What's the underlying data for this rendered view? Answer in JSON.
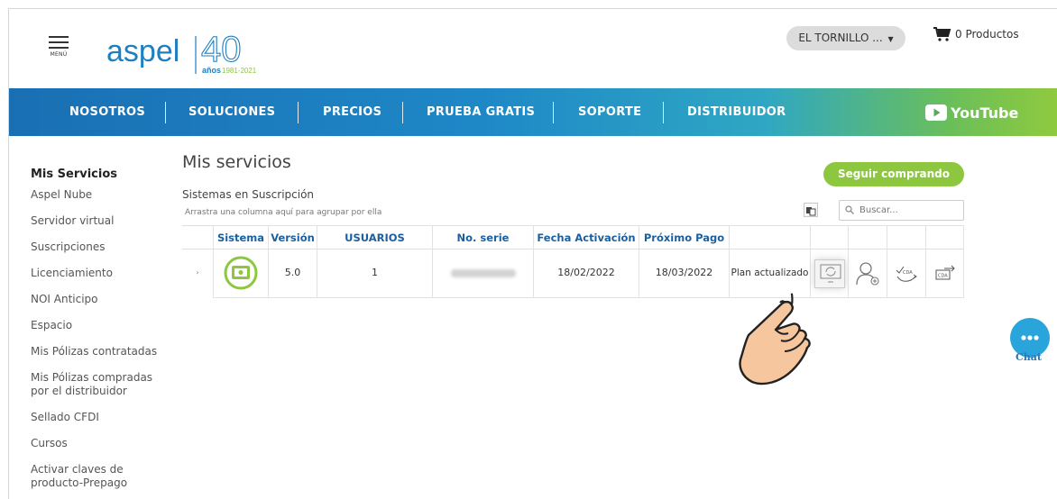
{
  "header": {
    "menu_label": "MENÚ",
    "brand": "aspel",
    "anniversary_number": "40",
    "anniversary_text": "años",
    "anniversary_years": "1981-2021",
    "account_label": "EL TORNILLO ...",
    "cart_label": "0 Productos"
  },
  "nav": {
    "items": [
      "NOSOTROS",
      "SOLUCIONES",
      "PRECIOS",
      "PRUEBA GRATIS",
      "SOPORTE",
      "DISTRIBUIDOR"
    ],
    "youtube_label": "YouTube"
  },
  "sidebar": {
    "title": "Mis Servicios",
    "items": [
      "Aspel Nube",
      "Servidor virtual",
      "Suscripciones",
      "Licenciamiento",
      "NOI Anticipo",
      "Espacio",
      "Mis Pólizas contratadas",
      "Mis Pólizas compradas por el distribuidor",
      "Sellado CFDI",
      "Cursos",
      "Activar claves de producto-Prepago"
    ]
  },
  "main": {
    "title": "Mis servicios",
    "subtitle": "Sistemas en Suscripción",
    "group_hint": "Arrastra una columna aquí para agrupar por ella",
    "buy_button": "Seguir comprando",
    "search_placeholder": "Buscar...",
    "columns": [
      "Sistema",
      "Versión",
      "USUARIOS",
      "No. serie",
      "Fecha Activación",
      "Próximo Pago"
    ],
    "row": {
      "version": "5.0",
      "users": "1",
      "activation_date": "18/02/2022",
      "next_payment": "18/03/2022",
      "plan_status": "Plan actualizado"
    }
  },
  "chat_label": "Chat",
  "colors": {
    "accent_green": "#8dc63f",
    "header_blue": "#1c5f9e",
    "chat_blue": "#2aa5dc"
  }
}
